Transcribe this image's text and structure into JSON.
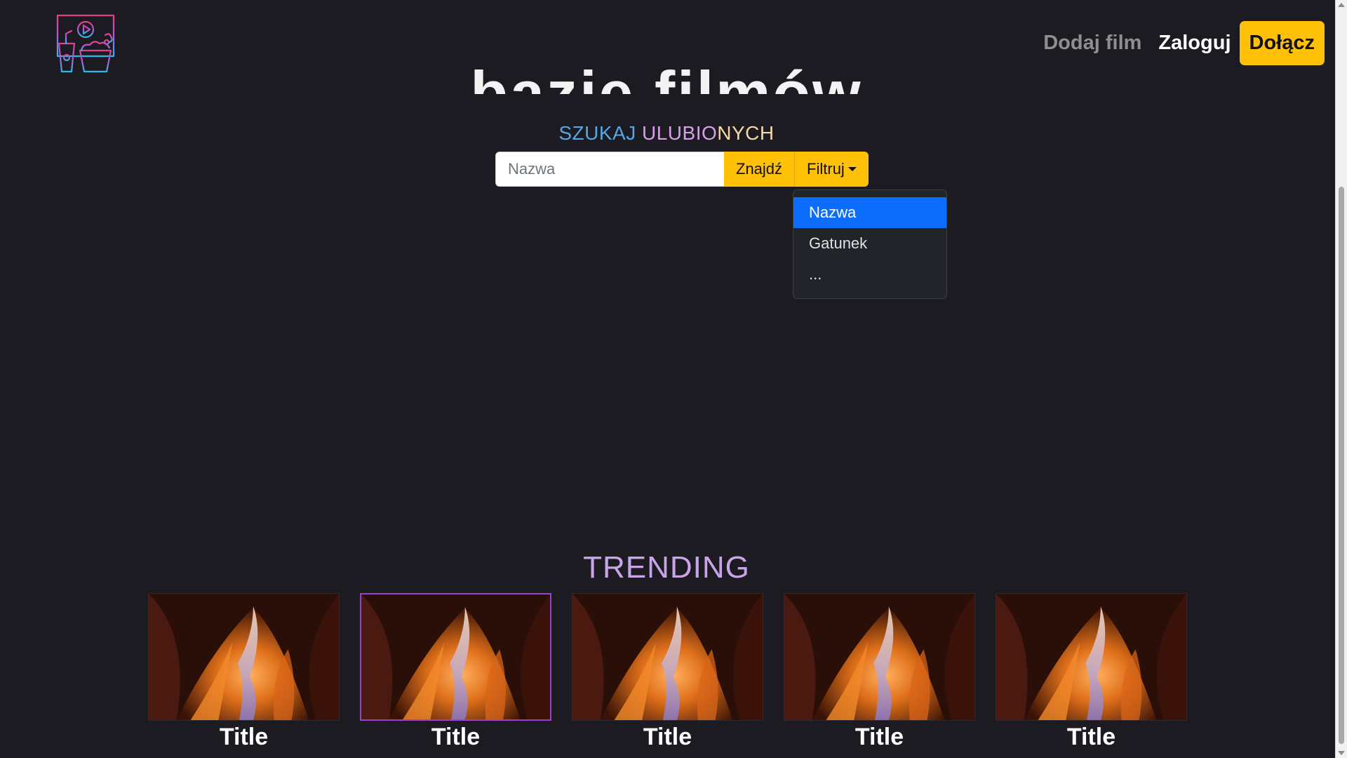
{
  "header": {
    "logo_icon": "cinema-snacks-logo-icon",
    "nav": {
      "add_movie": "Dodaj film",
      "login": "Zaloguj",
      "join": "Dołącz"
    }
  },
  "hero": {
    "title": "bazie filmów"
  },
  "search": {
    "heading_word1": "SZUKAJ",
    "heading_word2": "ULUBIO",
    "heading_word3": "NYCH",
    "placeholder": "Nazwa",
    "value": "",
    "find_button": "Znajdź",
    "filter_button": "Filtruj"
  },
  "filter_dropdown": {
    "items": [
      {
        "label": "Nazwa",
        "active": true
      },
      {
        "label": "Gatunek",
        "active": false
      },
      {
        "label": "...",
        "active": false
      }
    ]
  },
  "trending": {
    "title": "TRENDING",
    "cards": [
      {
        "title": "Title",
        "image": "canyon-photo"
      },
      {
        "title": "Title",
        "image": "canyon-photo"
      },
      {
        "title": "Title",
        "image": "canyon-photo"
      },
      {
        "title": "Title",
        "image": "canyon-photo"
      },
      {
        "title": "Title",
        "image": "canyon-photo"
      }
    ]
  },
  "colors": {
    "background": "#1c1b22",
    "accent_yellow": "#ffc107",
    "dropdown_active": "#0d6efd",
    "trending_title": "#c8a4e8",
    "selected_card_border": "#9b3fd1"
  }
}
